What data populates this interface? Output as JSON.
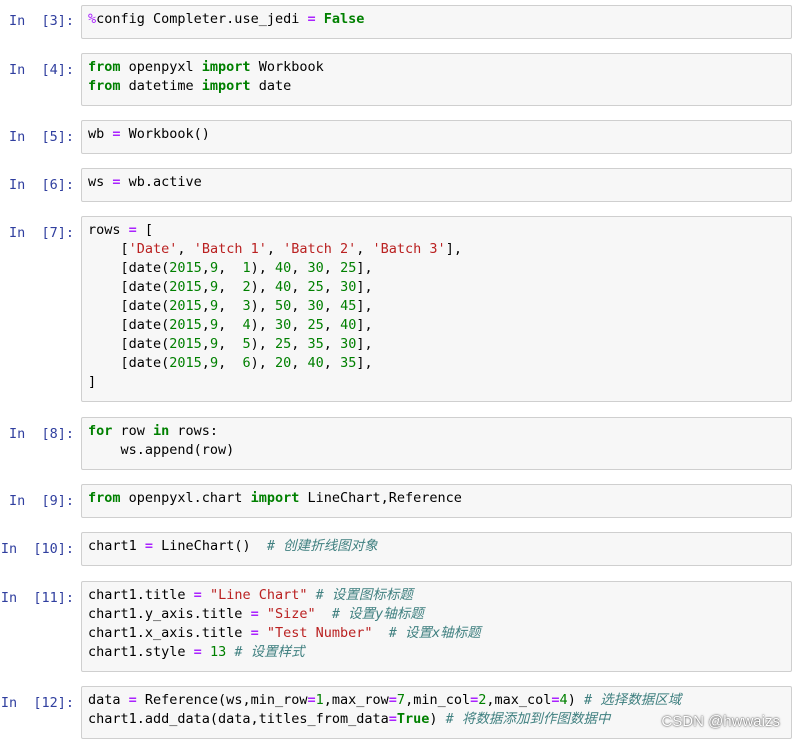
{
  "cells": [
    {
      "prompt": "In  [3]:",
      "lines": [
        [
          [
            "mag",
            "%"
          ],
          [
            "",
            "config Completer.use_jedi "
          ],
          [
            "op",
            "="
          ],
          [
            "",
            ""
          ],
          [
            "kw",
            " False"
          ]
        ]
      ]
    },
    {
      "prompt": "In  [4]:",
      "lines": [
        [
          [
            "kw",
            "from"
          ],
          [
            "",
            " openpyxl "
          ],
          [
            "kw",
            "import"
          ],
          [
            "",
            " Workbook"
          ]
        ],
        [
          [
            "kw",
            "from"
          ],
          [
            "",
            " datetime "
          ],
          [
            "kw",
            "import"
          ],
          [
            "",
            " date"
          ]
        ]
      ]
    },
    {
      "prompt": "In  [5]:",
      "lines": [
        [
          [
            "",
            "wb "
          ],
          [
            "op",
            "="
          ],
          [
            "",
            " Workbook()"
          ]
        ]
      ]
    },
    {
      "prompt": "In  [6]:",
      "lines": [
        [
          [
            "",
            "ws "
          ],
          [
            "op",
            "="
          ],
          [
            "",
            " wb.active"
          ]
        ]
      ]
    },
    {
      "prompt": "In  [7]:",
      "lines": [
        [
          [
            "",
            "rows "
          ],
          [
            "op",
            "="
          ],
          [
            "",
            " ["
          ]
        ],
        [
          [
            "",
            "    ["
          ],
          [
            "str",
            "'Date'"
          ],
          [
            "",
            ", "
          ],
          [
            "str",
            "'Batch 1'"
          ],
          [
            "",
            ", "
          ],
          [
            "str",
            "'Batch 2'"
          ],
          [
            "",
            ", "
          ],
          [
            "str",
            "'Batch 3'"
          ],
          [
            "",
            "],"
          ]
        ],
        [
          [
            "",
            "    [date("
          ],
          [
            "num",
            "2015"
          ],
          [
            "",
            ","
          ],
          [
            "num",
            "9"
          ],
          [
            "",
            ",  "
          ],
          [
            "num",
            "1"
          ],
          [
            "",
            "), "
          ],
          [
            "num",
            "40"
          ],
          [
            "",
            ", "
          ],
          [
            "num",
            "30"
          ],
          [
            "",
            ", "
          ],
          [
            "num",
            "25"
          ],
          [
            "",
            "],"
          ]
        ],
        [
          [
            "",
            "    [date("
          ],
          [
            "num",
            "2015"
          ],
          [
            "",
            ","
          ],
          [
            "num",
            "9"
          ],
          [
            "",
            ",  "
          ],
          [
            "num",
            "2"
          ],
          [
            "",
            "), "
          ],
          [
            "num",
            "40"
          ],
          [
            "",
            ", "
          ],
          [
            "num",
            "25"
          ],
          [
            "",
            ", "
          ],
          [
            "num",
            "30"
          ],
          [
            "",
            "],"
          ]
        ],
        [
          [
            "",
            "    [date("
          ],
          [
            "num",
            "2015"
          ],
          [
            "",
            ","
          ],
          [
            "num",
            "9"
          ],
          [
            "",
            ",  "
          ],
          [
            "num",
            "3"
          ],
          [
            "",
            "), "
          ],
          [
            "num",
            "50"
          ],
          [
            "",
            ", "
          ],
          [
            "num",
            "30"
          ],
          [
            "",
            ", "
          ],
          [
            "num",
            "45"
          ],
          [
            "",
            "],"
          ]
        ],
        [
          [
            "",
            "    [date("
          ],
          [
            "num",
            "2015"
          ],
          [
            "",
            ","
          ],
          [
            "num",
            "9"
          ],
          [
            "",
            ",  "
          ],
          [
            "num",
            "4"
          ],
          [
            "",
            "), "
          ],
          [
            "num",
            "30"
          ],
          [
            "",
            ", "
          ],
          [
            "num",
            "25"
          ],
          [
            "",
            ", "
          ],
          [
            "num",
            "40"
          ],
          [
            "",
            "],"
          ]
        ],
        [
          [
            "",
            "    [date("
          ],
          [
            "num",
            "2015"
          ],
          [
            "",
            ","
          ],
          [
            "num",
            "9"
          ],
          [
            "",
            ",  "
          ],
          [
            "num",
            "5"
          ],
          [
            "",
            "), "
          ],
          [
            "num",
            "25"
          ],
          [
            "",
            ", "
          ],
          [
            "num",
            "35"
          ],
          [
            "",
            ", "
          ],
          [
            "num",
            "30"
          ],
          [
            "",
            "],"
          ]
        ],
        [
          [
            "",
            "    [date("
          ],
          [
            "num",
            "2015"
          ],
          [
            "",
            ","
          ],
          [
            "num",
            "9"
          ],
          [
            "",
            ",  "
          ],
          [
            "num",
            "6"
          ],
          [
            "",
            "), "
          ],
          [
            "num",
            "20"
          ],
          [
            "",
            ", "
          ],
          [
            "num",
            "40"
          ],
          [
            "",
            ", "
          ],
          [
            "num",
            "35"
          ],
          [
            "",
            "],"
          ]
        ],
        [
          [
            "",
            "]"
          ]
        ]
      ]
    },
    {
      "prompt": "In  [8]:",
      "lines": [
        [
          [
            "kw",
            "for"
          ],
          [
            "",
            " row "
          ],
          [
            "kw",
            "in"
          ],
          [
            "",
            " rows:"
          ]
        ],
        [
          [
            "",
            "    ws.append(row)"
          ]
        ]
      ]
    },
    {
      "prompt": "In  [9]:",
      "lines": [
        [
          [
            "kw",
            "from"
          ],
          [
            "",
            " openpyxl.chart "
          ],
          [
            "kw",
            "import"
          ],
          [
            "",
            " LineChart,Reference"
          ]
        ]
      ]
    },
    {
      "prompt": "In  [10]:",
      "lines": [
        [
          [
            "",
            "chart1 "
          ],
          [
            "op",
            "="
          ],
          [
            "",
            " LineChart()  "
          ],
          [
            "cmt",
            "# 创建折线图对象"
          ]
        ]
      ]
    },
    {
      "prompt": "In  [11]:",
      "lines": [
        [
          [
            "",
            "chart1.title "
          ],
          [
            "op",
            "="
          ],
          [
            "",
            " "
          ],
          [
            "str",
            "\"Line Chart\""
          ],
          [
            "",
            " "
          ],
          [
            "cmt",
            "# 设置图标标题"
          ]
        ],
        [
          [
            "",
            "chart1.y_axis.title "
          ],
          [
            "op",
            "="
          ],
          [
            "",
            " "
          ],
          [
            "str",
            "\"Size\""
          ],
          [
            "",
            "  "
          ],
          [
            "cmt",
            "# 设置y轴标题"
          ]
        ],
        [
          [
            "",
            "chart1.x_axis.title "
          ],
          [
            "op",
            "="
          ],
          [
            "",
            " "
          ],
          [
            "str",
            "\"Test Number\""
          ],
          [
            "",
            "  "
          ],
          [
            "cmt",
            "# 设置x轴标题"
          ]
        ],
        [
          [
            "",
            "chart1.style "
          ],
          [
            "op",
            "="
          ],
          [
            "",
            " "
          ],
          [
            "num",
            "13"
          ],
          [
            "",
            " "
          ],
          [
            "cmt",
            "# 设置样式"
          ]
        ]
      ]
    },
    {
      "prompt": "In  [12]:",
      "lines": [
        [
          [
            "",
            "data "
          ],
          [
            "op",
            "="
          ],
          [
            "",
            " Reference(ws,min_row"
          ],
          [
            "op",
            "="
          ],
          [
            "num",
            "1"
          ],
          [
            "",
            ",max_row"
          ],
          [
            "op",
            "="
          ],
          [
            "num",
            "7"
          ],
          [
            "",
            ",min_col"
          ],
          [
            "op",
            "="
          ],
          [
            "num",
            "2"
          ],
          [
            "",
            ",max_col"
          ],
          [
            "op",
            "="
          ],
          [
            "num",
            "4"
          ],
          [
            "",
            ") "
          ],
          [
            "cmt",
            "# 选择数据区域"
          ]
        ],
        [
          [
            "",
            "chart1.add_data(data,titles_from_data"
          ],
          [
            "op",
            "="
          ],
          [
            "kw",
            "True"
          ],
          [
            "",
            ") "
          ],
          [
            "cmt",
            "# 将数据添加到作图数据中"
          ]
        ]
      ]
    }
  ],
  "watermark": "CSDN @hwwaizs"
}
